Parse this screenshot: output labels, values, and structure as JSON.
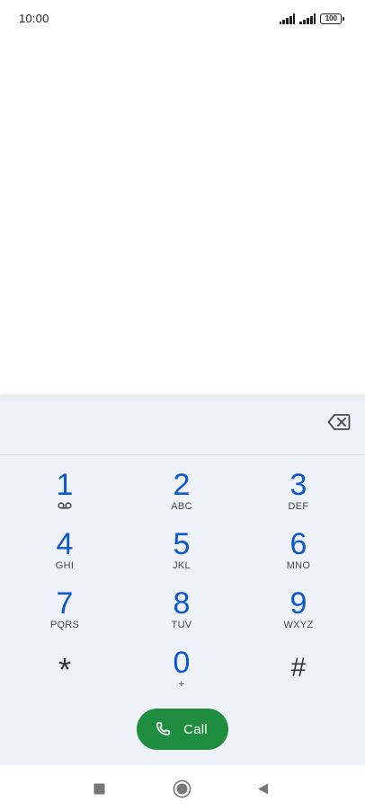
{
  "status_bar": {
    "time": "10:00",
    "battery": "100",
    "icons": [
      "signal-icon",
      "signal-icon",
      "battery-icon"
    ]
  },
  "dialer": {
    "number_value": "",
    "backspace_icon": "backspace-icon",
    "keys": [
      {
        "digit": "1",
        "letters": "",
        "icon": "voicemail-icon"
      },
      {
        "digit": "2",
        "letters": "ABC"
      },
      {
        "digit": "3",
        "letters": "DEF"
      },
      {
        "digit": "4",
        "letters": "GHI"
      },
      {
        "digit": "5",
        "letters": "JKL"
      },
      {
        "digit": "6",
        "letters": "MNO"
      },
      {
        "digit": "7",
        "letters": "PQRS"
      },
      {
        "digit": "8",
        "letters": "TUV"
      },
      {
        "digit": "9",
        "letters": "WXYZ"
      },
      {
        "digit": "*",
        "letters": ""
      },
      {
        "digit": "0",
        "letters": "+"
      },
      {
        "digit": "#",
        "letters": ""
      }
    ],
    "call_label": "Call",
    "call_icon": "phone-icon"
  },
  "nav_bar": {
    "icons": [
      "recents-square-icon",
      "home-circle-icon",
      "back-triangle-icon"
    ]
  },
  "colors": {
    "digit": "#0b57d0",
    "call_button": "#1e8e3e",
    "sheet_background": "#eff3f9"
  }
}
